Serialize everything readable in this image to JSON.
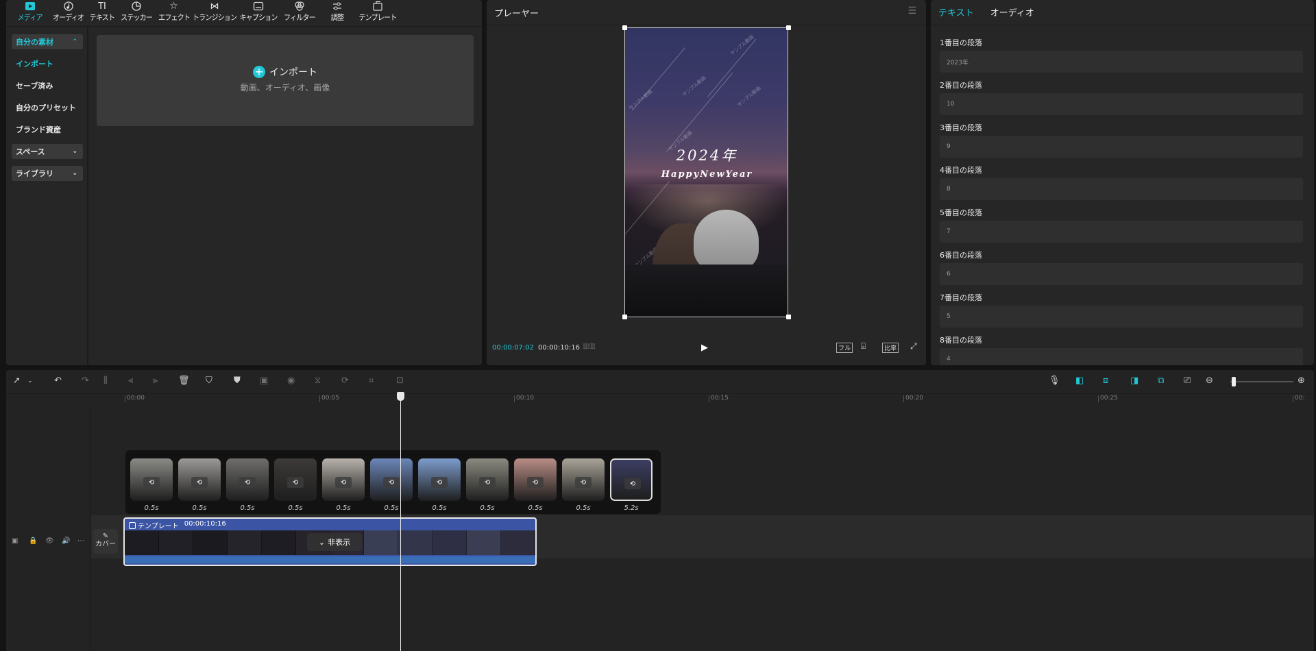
{
  "media": {
    "tabs": [
      {
        "label": "メディア",
        "icon": "media-icon",
        "active": true
      },
      {
        "label": "オーディオ",
        "icon": "audio-icon"
      },
      {
        "label": "テキスト",
        "icon": "text-icon"
      },
      {
        "label": "ステッカー",
        "icon": "sticker-icon"
      },
      {
        "label": "エフェクト",
        "icon": "effect-icon"
      },
      {
        "label": "トランジション",
        "icon": "transition-icon"
      },
      {
        "label": "キャプション",
        "icon": "caption-icon"
      },
      {
        "label": "フィルター",
        "icon": "filter-icon"
      },
      {
        "label": "調整",
        "icon": "adjust-icon"
      },
      {
        "label": "テンプレート",
        "icon": "template-icon"
      }
    ],
    "sidebar": {
      "my_materials": "自分の素材",
      "import": "インポート",
      "saved": "セーブ済み",
      "my_presets": "自分のプリセット",
      "brand_assets": "ブランド資産",
      "space": "スペース",
      "library": "ライブラリ"
    },
    "drop": {
      "label": "インポート",
      "sub": "動画、オーディオ、画像"
    }
  },
  "player": {
    "title": "プレーヤー",
    "year_text": "2024年",
    "greeting": "HappyNewYear",
    "watermark": "サンプル動画",
    "current_time": "00:00:07:02",
    "total_time": "00:00:10:16",
    "ratio_label": "フル",
    "aspect_label": "比率"
  },
  "inspector": {
    "tabs": [
      "テキスト",
      "オーディオ"
    ],
    "paragraphs": [
      {
        "label": "1番目の段落",
        "value": "2023年"
      },
      {
        "label": "2番目の段落",
        "value": "10"
      },
      {
        "label": "3番目の段落",
        "value": "9"
      },
      {
        "label": "4番目の段落",
        "value": "8"
      },
      {
        "label": "5番目の段落",
        "value": "7"
      },
      {
        "label": "6番目の段落",
        "value": "6"
      },
      {
        "label": "7番目の段落",
        "value": "5"
      },
      {
        "label": "8番目の段落",
        "value": "4"
      }
    ]
  },
  "timeline": {
    "ruler": [
      "00:00",
      "00:05",
      "00:10",
      "00:15",
      "00:20",
      "00:25",
      "00:"
    ],
    "clips": [
      {
        "duration": "0.5s",
        "color": "#8a8a86"
      },
      {
        "duration": "0.5s",
        "color": "#9b9a98"
      },
      {
        "duration": "0.5s",
        "color": "#6f6e6c"
      },
      {
        "duration": "0.5s",
        "color": "#3d3a38"
      },
      {
        "duration": "0.5s",
        "color": "#b7b2ab"
      },
      {
        "duration": "0.5s",
        "color": "#6b86b8"
      },
      {
        "duration": "0.5s",
        "color": "#7d9ccc"
      },
      {
        "duration": "0.5s",
        "color": "#8b8a80"
      },
      {
        "duration": "0.5s",
        "color": "#b98d86"
      },
      {
        "duration": "0.5s",
        "color": "#a9a499"
      },
      {
        "duration": "5.2s",
        "color": "#3c3e62"
      }
    ],
    "template_clip": {
      "label": "テンプレート",
      "duration": "00:00:10:16",
      "hide_label": "非表示"
    },
    "cover_label": "カバー",
    "zoom_level": 0.05
  },
  "colors": {
    "accent": "#22c7d6",
    "template_clip": "#3b55a4"
  }
}
